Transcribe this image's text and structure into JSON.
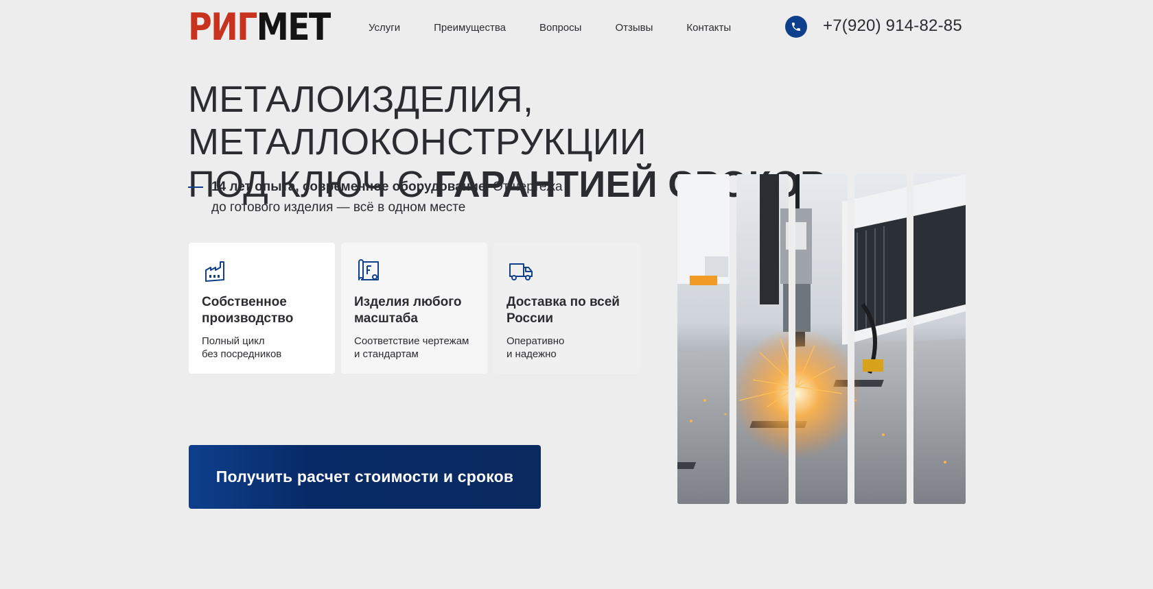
{
  "brand": {
    "logo_red": "РИГ",
    "logo_dark": "МЕТ"
  },
  "nav": [
    "Услуги",
    "Преимущества",
    "Вопросы",
    "Отзывы",
    "Контакты"
  ],
  "contact": {
    "phone": "+7(920) 914-82-85",
    "icon": "phone-icon"
  },
  "hero": {
    "line1": "МЕТАЛОИЗДЕЛИЯ, МЕТАЛЛОКОНСТРУКЦИИ",
    "line2_regular": "ПОД КЛЮЧ С ",
    "line2_bold": "ГАРАНТИЕЙ СРОКОВ",
    "sub_bold": "14 лет опыта, современное оборудование.",
    "sub_rest": " От чертежа",
    "sub_line2": "до готового изделия — всё в одном месте"
  },
  "features": [
    {
      "icon": "factory-icon",
      "title": "Собственное производство",
      "desc_line1": "Полный цикл",
      "desc_line2": "без посредников"
    },
    {
      "icon": "blueprint-icon",
      "title": "Изделия любого масштаба",
      "desc_line1": "Соответствие чертежам",
      "desc_line2": "и стандартам"
    },
    {
      "icon": "truck-icon",
      "title": "Доставка по всей России",
      "desc_line1": "Оперативно",
      "desc_line2": "и надежно"
    }
  ],
  "cta": {
    "label": "Получить расчет стоимости и сроков"
  },
  "colors": {
    "accent": "#0e3f8c",
    "logo_red": "#c8331f",
    "background": "#ededee"
  }
}
